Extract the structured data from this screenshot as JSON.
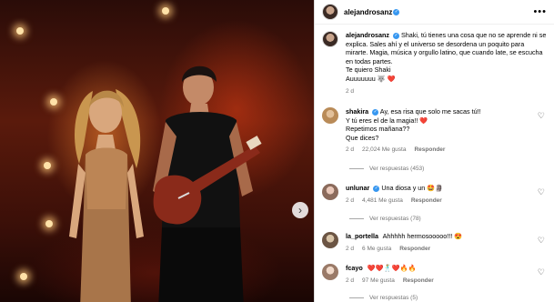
{
  "post": {
    "author": "alejandrosanz",
    "caption_user": "alejandrosanz",
    "caption": "Shaki, tú tienes una cosa que no se aprende ni se explica. Sales ahí y el universo se desordena un poquito para mirarte. Magia, música y orgullo latino, que cuando late, se escucha en todas partes.",
    "caption_line2": "Te quiero Shaki",
    "caption_line3": "Auuuuuuu 🐺 ❤️",
    "caption_time": "2 d",
    "more_icon": "•••",
    "next_icon": "›"
  },
  "comments": [
    {
      "user": "shakira",
      "text_lines": [
        "Ay, esa risa que solo me sacas tú!!",
        "Y tú eres el de la magia!! ❤️",
        "Repetimos mañana??",
        "Que dices?"
      ],
      "time": "2 d",
      "likes": "22,024 Me gusta",
      "reply": "Responder",
      "view_replies": "Ver respuestas (453)"
    },
    {
      "user": "unlunar",
      "text_lines": [
        "Una diosa y un 🤩🗿"
      ],
      "time": "2 d",
      "likes": "4,481 Me gusta",
      "reply": "Responder",
      "view_replies": "Ver respuestas (78)"
    },
    {
      "user": "la_portella",
      "text_lines": [
        "Ahhhhh hermosooooo!!! 😍"
      ],
      "time": "2 d",
      "likes": "6 Me gusta",
      "reply": "Responder",
      "view_replies": ""
    },
    {
      "user": "fcayo",
      "text_lines": [
        "❤️❤️🕺❤️🔥🔥"
      ],
      "time": "2 d",
      "likes": "97 Me gusta",
      "reply": "Responder",
      "view_replies": "Ver respuestas (5)"
    }
  ],
  "icons": {
    "heart": "♡"
  }
}
